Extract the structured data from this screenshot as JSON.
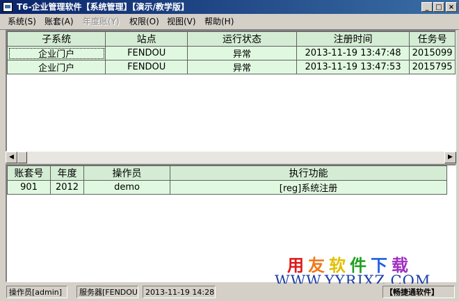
{
  "window": {
    "title": "T6-企业管理软件【系统管理】【演示/教学版】",
    "minimize": "_",
    "maximize": "□",
    "close": "×"
  },
  "menu": [
    {
      "label": "系统(S)",
      "enabled": true
    },
    {
      "label": "账套(A)",
      "enabled": true
    },
    {
      "label": "年度账(Y)",
      "enabled": false
    },
    {
      "label": "权限(O)",
      "enabled": true
    },
    {
      "label": "视图(V)",
      "enabled": true
    },
    {
      "label": "帮助(H)",
      "enabled": true
    }
  ],
  "upper_table": {
    "columns": [
      "子系统",
      "站点",
      "运行状态",
      "注册时间",
      "任务号"
    ],
    "rows": [
      [
        "企业门户",
        "FENDOU",
        "异常",
        "2013-11-19 13:47:48",
        "2015099"
      ],
      [
        "企业门户",
        "FENDOU",
        "异常",
        "2013-11-19 13:47:53",
        "2015795"
      ]
    ]
  },
  "scrollbar": {
    "left": "◀",
    "right": "▶"
  },
  "lower_table": {
    "columns": [
      "账套号",
      "年度",
      "操作员",
      "执行功能"
    ],
    "rows": [
      [
        "901",
        "2012",
        "demo",
        "[reg]系统注册"
      ]
    ]
  },
  "status": {
    "operator": "操作员[admin]",
    "server": "服务器[FENDOU]",
    "datetime": "2013-11-19 14:28",
    "brand": "【畅捷通软件】"
  },
  "watermark": {
    "chinese": [
      "用",
      "友",
      "软",
      "件",
      "下",
      "载"
    ],
    "chinese_colors": [
      "#e01818",
      "#f07818",
      "#e0c000",
      "#20a020",
      "#2060e0",
      "#a030c0"
    ],
    "url": "WWW.YYRJXZ.COM"
  },
  "colors": {
    "titlebar": "#0a246a",
    "grid_header": "#d4ecd4",
    "grid_cell": "#e0f8e0",
    "face": "#d4d0c8"
  }
}
